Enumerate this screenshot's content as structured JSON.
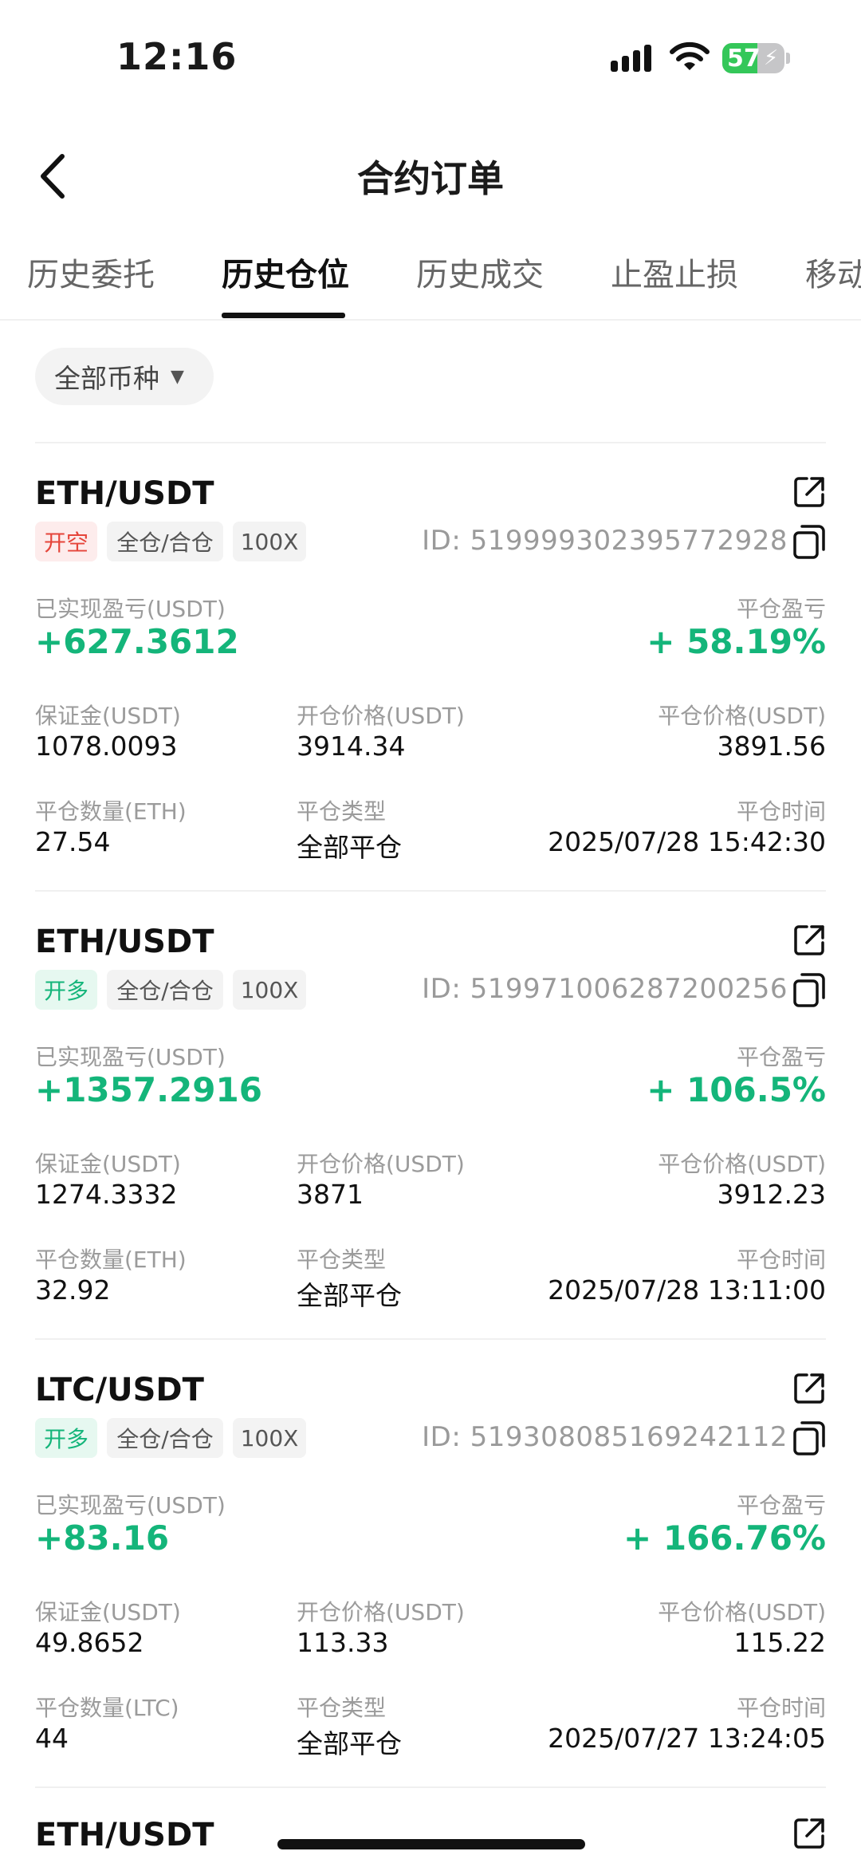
{
  "status_bar": {
    "time": "12:16",
    "battery": "57"
  },
  "header": {
    "title": "合约订单"
  },
  "tabs": [
    "历史委托",
    "历史仓位",
    "历史成交",
    "止盈止损",
    "移动"
  ],
  "filter": {
    "label": "全部币种"
  },
  "labels": {
    "realized_pnl": "已实现盈亏(USDT)",
    "close_pnl": "平仓盈亏",
    "margin": "保证金(USDT)",
    "open_price": "开仓价格(USDT)",
    "close_price": "平仓价格(USDT)",
    "close_type": "平仓类型",
    "close_time": "平仓时间",
    "id_prefix": "ID:"
  },
  "orders": [
    {
      "pair": "ETH/USDT",
      "side": "开空",
      "mode": "全仓/合仓",
      "leverage": "100X",
      "id": "519999302395772928",
      "realized_pnl": "+627.3612",
      "close_pnl_pct": "+ 58.19%",
      "margin": "1078.0093",
      "open_price": "3914.34",
      "close_price": "3891.56",
      "qty_label": "平仓数量(ETH)",
      "qty": "27.54",
      "close_type": "全部平仓",
      "close_time": "2025/07/28 15:42:30"
    },
    {
      "pair": "ETH/USDT",
      "side": "开多",
      "mode": "全仓/合仓",
      "leverage": "100X",
      "id": "519971006287200256",
      "realized_pnl": "+1357.2916",
      "close_pnl_pct": "+ 106.5%",
      "margin": "1274.3332",
      "open_price": "3871",
      "close_price": "3912.23",
      "qty_label": "平仓数量(ETH)",
      "qty": "32.92",
      "close_type": "全部平仓",
      "close_time": "2025/07/28 13:11:00"
    },
    {
      "pair": "LTC/USDT",
      "side": "开多",
      "mode": "全仓/合仓",
      "leverage": "100X",
      "id": "519308085169242112",
      "realized_pnl": "+83.16",
      "close_pnl_pct": "+ 166.76%",
      "margin": "49.8652",
      "open_price": "113.33",
      "close_price": "115.22",
      "qty_label": "平仓数量(LTC)",
      "qty": "44",
      "close_type": "全部平仓",
      "close_time": "2025/07/27 13:24:05"
    },
    {
      "pair": "ETH/USDT"
    }
  ],
  "colors": {
    "profit": "#14b57a",
    "short": "#e5453a",
    "long": "#14b57a"
  }
}
